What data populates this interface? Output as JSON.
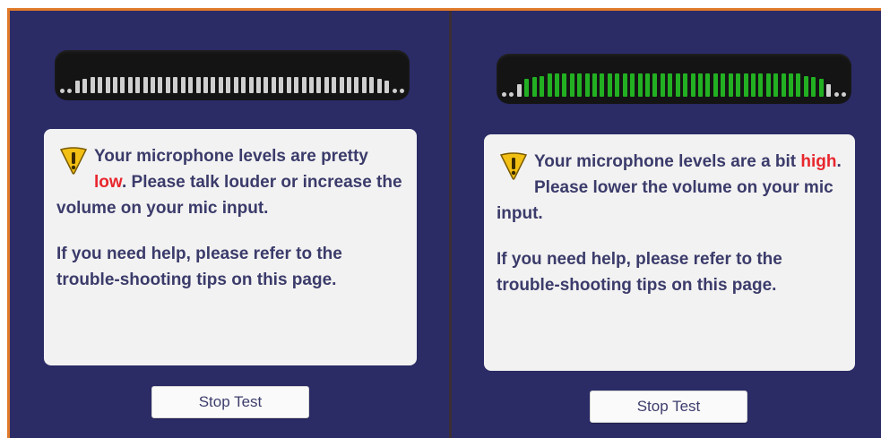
{
  "panels": [
    {
      "meter": {
        "level": 0.0,
        "active_bars": 0
      },
      "message": {
        "pre": "Your microphone levels are pretty ",
        "highlight": "low",
        "post": ". Please talk louder or increase the volume on your mic input.",
        "help": "If you need help, please refer to the trouble-shooting tips on this page."
      },
      "button_label": "Stop Test"
    },
    {
      "meter": {
        "level": 0.9,
        "active_bars": 40
      },
      "message": {
        "pre": "Your microphone levels are a bit ",
        "highlight": "high",
        "post": ".  Please lower the volume on your mic input.",
        "help": "If you need help, please refer to the trouble-shooting tips on this page."
      },
      "button_label": "Stop Test"
    }
  ],
  "colors": {
    "background": "#2b2b66",
    "frame_border": "#e07a2a",
    "meter_bg": "#141414",
    "bar_off": "#cfcfcf",
    "bar_on": "#22b022",
    "highlight": "#e8262d",
    "text": "#3b3b6b"
  },
  "icons": [
    "warning-icon"
  ]
}
